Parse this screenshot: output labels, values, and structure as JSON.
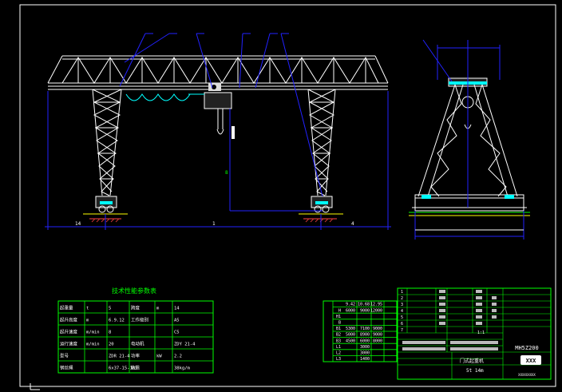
{
  "drawing": {
    "title": "技术性能参数表",
    "code": "MH5Z200",
    "title_block_name": "门式起重机",
    "title_block_spec": "5t  14m",
    "logo_text": "XXX",
    "company_line": "XXXXXXXXX",
    "scale_mark": "1:1"
  },
  "front_view": {
    "dims": [
      "14",
      "1",
      "4"
    ],
    "mid_mark": "8"
  },
  "spec_table": {
    "rows": [
      [
        "起重量",
        "t",
        "5",
        "跨度",
        "m",
        "14"
      ],
      [
        "起升高度",
        "m",
        "6.9.12",
        "工作级别",
        "",
        "A5"
      ],
      [
        "起升速度",
        "m/min",
        "8",
        "",
        "",
        "C5"
      ],
      [
        "运行速度",
        "m/min",
        "20",
        "电动机",
        "",
        "ZDY 21-4"
      ],
      [
        "型号",
        "",
        "ZDR 21-4",
        "功率",
        "kW",
        "2.2"
      ],
      [
        "钢丝绳",
        "",
        "6x37-15-185",
        "轨道",
        "",
        "38kg/m"
      ]
    ]
  },
  "dim_table": {
    "header": [
      "",
      "9.42",
      "10.68",
      "12.95"
    ],
    "rows": [
      [
        "H",
        "6000",
        "9000",
        "12000"
      ],
      [
        "H1",
        "",
        "",
        ""
      ],
      [
        "B",
        "",
        "",
        ""
      ],
      [
        "B1",
        "5300",
        "7100",
        "9000"
      ],
      [
        "B2",
        "5000",
        "8900",
        "9000"
      ],
      [
        "B3",
        "4500",
        "6000",
        "8000"
      ],
      [
        "L1",
        "",
        "3000",
        ""
      ],
      [
        "L2",
        "",
        "3000",
        ""
      ],
      [
        "L3",
        "",
        "1400",
        ""
      ]
    ]
  }
}
